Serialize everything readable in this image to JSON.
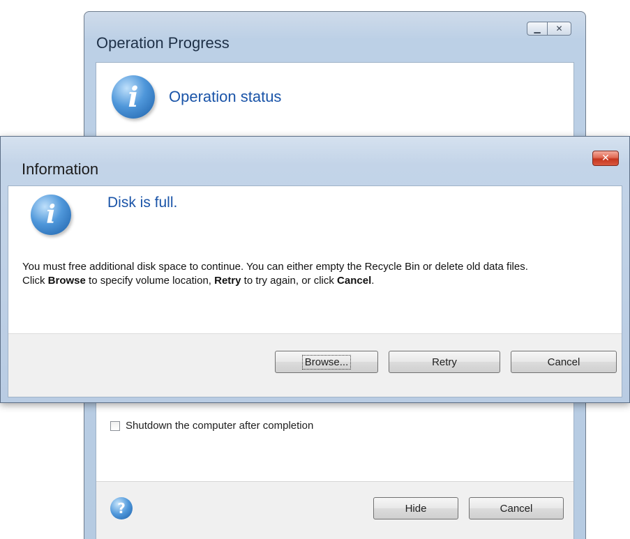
{
  "back_window": {
    "title": "Operation Progress",
    "minimize_icon": "minimize-icon",
    "close_icon": "close-icon",
    "header_icon": "info-icon",
    "status_heading": "Operation status",
    "checkbox_label": "Shutdown the computer after completion",
    "checkbox_checked": false,
    "help_icon": "help-icon",
    "hide_button": "Hide",
    "cancel_button": "Cancel"
  },
  "dialog": {
    "title": "Information",
    "close_icon": "close-icon",
    "header_icon": "info-icon",
    "heading": "Disk is full.",
    "message_line1": "You must free additional disk space to continue. You can either empty the Recycle Bin or delete old data files.",
    "message_line2_parts": [
      "Click ",
      "Browse",
      " to specify volume location, ",
      "Retry",
      " to try again, or click ",
      "Cancel",
      "."
    ],
    "browse_button": "Browse...",
    "retry_button": "Retry",
    "cancel_button": "Cancel"
  },
  "colors": {
    "heading_blue": "#1a54a8",
    "close_red": "#c5351e",
    "frame_blue": "#bcd0e6"
  }
}
